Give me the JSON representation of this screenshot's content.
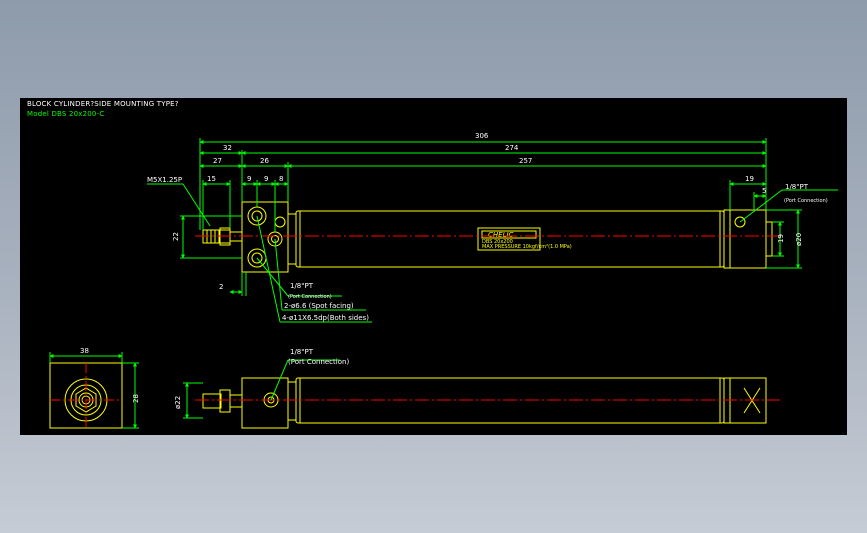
{
  "drawing": {
    "title": "BLOCK CYLINDER?SIDE MOUNTING TYPE?",
    "model": "Model  DBS 20x200-C"
  },
  "dimensions": {
    "overall": "306",
    "d32": "32",
    "d274": "274",
    "d27": "27",
    "d26": "26",
    "d257": "257",
    "thread": "M5X1.25P",
    "d15": "15",
    "d9a": "9",
    "d9b": "9",
    "d8": "8",
    "d19": "19",
    "d5": "5",
    "d22": "22",
    "d2": "2",
    "d19v": "19",
    "dia20": "ø20",
    "d38": "38",
    "d28": "28",
    "dia22": "ø22"
  },
  "callouts": {
    "port_top_right": "1/8\"PT",
    "port_conn_top_right": "(Port Connection)",
    "port_mid": "1/8\"PT",
    "port_conn_mid": "(Port Connection)",
    "spot_facing": "2-ø6.6 (Spot facing)",
    "counterbore": "4-ø11X6.5dp(Both sides)",
    "port_bottom": "1/8\"PT",
    "port_conn_bottom": "(Port Connection)"
  },
  "label": {
    "brand": "CHELIC",
    "line1": "DBS 20x200",
    "line2": "MAX PRESSURE 10kgf/cm²(1.0 MPa)"
  },
  "colors": {
    "background": "#000000",
    "outline": "#ffff00",
    "dimension": "#00ff00",
    "centerline": "#ff0000",
    "text": "#ffffff"
  }
}
